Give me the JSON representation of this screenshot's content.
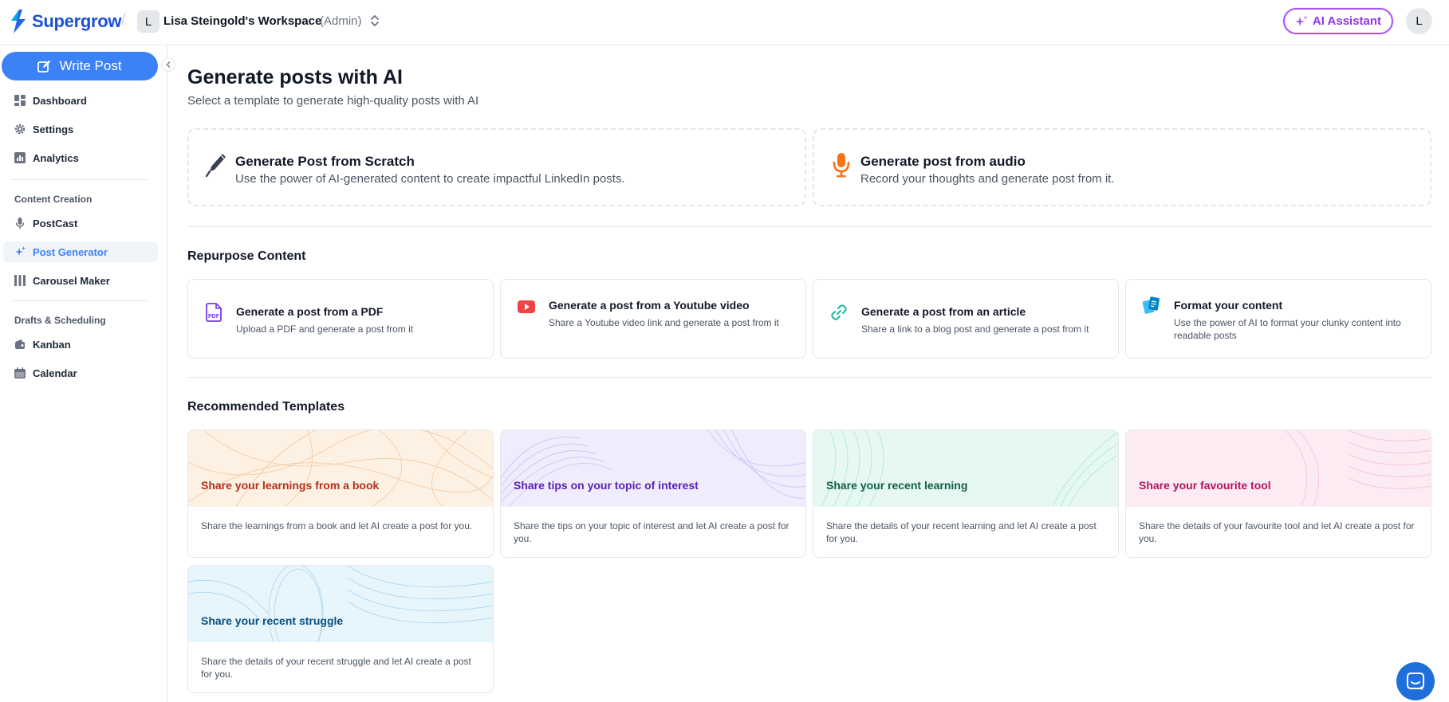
{
  "header": {
    "brand": "Supergrow",
    "separator": "/",
    "workspace_initial": "L",
    "workspace_name": "Lisa Steingold's Workspace",
    "workspace_role": "(Admin)",
    "ai_assistant_label": "AI Assistant",
    "user_initial": "L"
  },
  "sidebar": {
    "write_post_label": "Write Post",
    "items": [
      {
        "label": "Dashboard",
        "icon": "dashboard-icon"
      },
      {
        "label": "Settings",
        "icon": "gear-icon"
      },
      {
        "label": "Analytics",
        "icon": "bar-chart-icon"
      }
    ],
    "sections": [
      {
        "title": "Content Creation",
        "items": [
          {
            "label": "PostCast",
            "icon": "microphone-icon"
          },
          {
            "label": "Post Generator",
            "icon": "sparkles-icon",
            "active": true
          },
          {
            "label": "Carousel Maker",
            "icon": "columns-icon"
          }
        ]
      },
      {
        "title": "Drafts & Scheduling",
        "items": [
          {
            "label": "Kanban",
            "icon": "kanban-icon"
          },
          {
            "label": "Calendar",
            "icon": "calendar-icon"
          }
        ]
      }
    ]
  },
  "main": {
    "title": "Generate posts with AI",
    "subtitle": "Select a template to generate high-quality posts with AI",
    "generate_cards": [
      {
        "title": "Generate Post from Scratch",
        "description": "Use the power of AI-generated content to create impactful LinkedIn posts.",
        "icon": "pen-icon"
      },
      {
        "title": "Generate post from audio",
        "description": "Record your thoughts and generate post from it.",
        "icon": "microphone-icon"
      }
    ],
    "repurpose": {
      "title": "Repurpose Content",
      "cards": [
        {
          "title": "Generate a post from a PDF",
          "description": "Upload a PDF and generate a post from it",
          "icon": "pdf-icon"
        },
        {
          "title": "Generate a post from a Youtube video",
          "description": "Share a Youtube video link and generate a post from it",
          "icon": "youtube-icon"
        },
        {
          "title": "Generate a post from an article",
          "description": "Share a link to a blog post and generate a post from it",
          "icon": "link-icon"
        },
        {
          "title": "Format your content",
          "description": "Use the power of AI to format your clunky content into readable posts",
          "icon": "format-cards-icon"
        }
      ]
    },
    "templates": {
      "title": "Recommended Templates",
      "cards": [
        {
          "title": "Share your learnings from a book",
          "description": "Share the learnings from a book and let AI create a post for you.",
          "bg": "#fdf1e4",
          "line": "#f5c79a",
          "color": "#b5301a"
        },
        {
          "title": "Share tips on your topic of interest",
          "description": "Share the tips on your topic of interest and let AI create a post for you.",
          "bg": "#efecfd",
          "line": "#c9c0f5",
          "color": "#5b21b6"
        },
        {
          "title": "Share your recent learning",
          "description": "Share the details of your recent learning and let AI create a post for you.",
          "bg": "#e6f8f1",
          "line": "#a9e6d2",
          "color": "#0f5e4a"
        },
        {
          "title": "Share your favourite tool",
          "description": "Share the details of your favourite tool and let AI create a post for you.",
          "bg": "#fdebf3",
          "line": "#f5c0d8",
          "color": "#b0155e"
        },
        {
          "title": "Share your recent struggle",
          "description": "Share the details of your recent struggle and let AI create a post for you.",
          "bg": "#e7f5fd",
          "line": "#a9d6f0",
          "color": "#0c4f80"
        }
      ]
    }
  },
  "colors": {
    "primary": "#3b82f6",
    "ai_accent": "#a855f7",
    "chat_button": "#1e6fd9"
  }
}
